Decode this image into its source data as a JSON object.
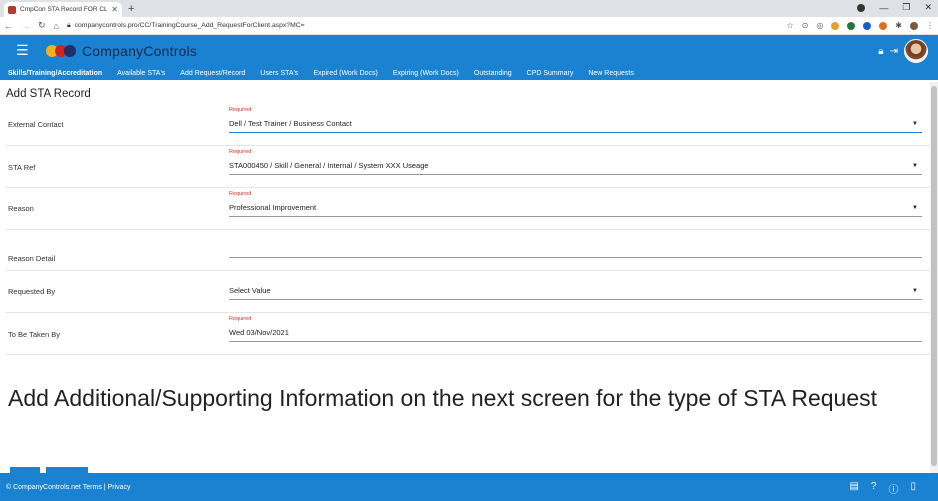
{
  "browser": {
    "tab_title": "CmpCon STA Record FOR CLIENT",
    "url": "companycontrols.pro/CC/TrainingCourse_Add_RequestForClient.aspx?MC="
  },
  "app": {
    "brand": "CompanyControls",
    "accent": "#1a82d1"
  },
  "nav": {
    "items": [
      "Skills/Training/Accreditation",
      "Available STA's",
      "Add Request/Record",
      "Users STA's",
      "Expired (Work Docs)",
      "Expiring (Work Docs)",
      "Outstanding",
      "CPD Summary",
      "New Requests"
    ]
  },
  "page": {
    "title": "Add STA Record",
    "required_label": "Required",
    "fields": [
      {
        "label": "External Contact",
        "value": "Dell / Test Trainer / Business Contact",
        "required": true,
        "dropdown": true
      },
      {
        "label": "STA Ref",
        "value": "STA000450 / Skill / General / Internal / System XXX Useage",
        "required": true,
        "dropdown": true
      },
      {
        "label": "Reason",
        "value": "Professional Improvement",
        "required": true,
        "dropdown": true
      },
      {
        "label": "Reason Detail",
        "value": "",
        "required": false,
        "dropdown": false
      },
      {
        "label": "Requested By",
        "value": "Select Value",
        "required": false,
        "dropdown": true
      },
      {
        "label": "To Be Taken By",
        "value": "Wed 03/Nov/2021",
        "required": true,
        "dropdown": false
      }
    ],
    "info_message": "Add Additional/Supporting Information on the next screen for the type of STA Request"
  },
  "footer": {
    "copyright": "© CompanyControls.net",
    "terms": "Terms",
    "separator": "|",
    "privacy": "Privacy"
  }
}
